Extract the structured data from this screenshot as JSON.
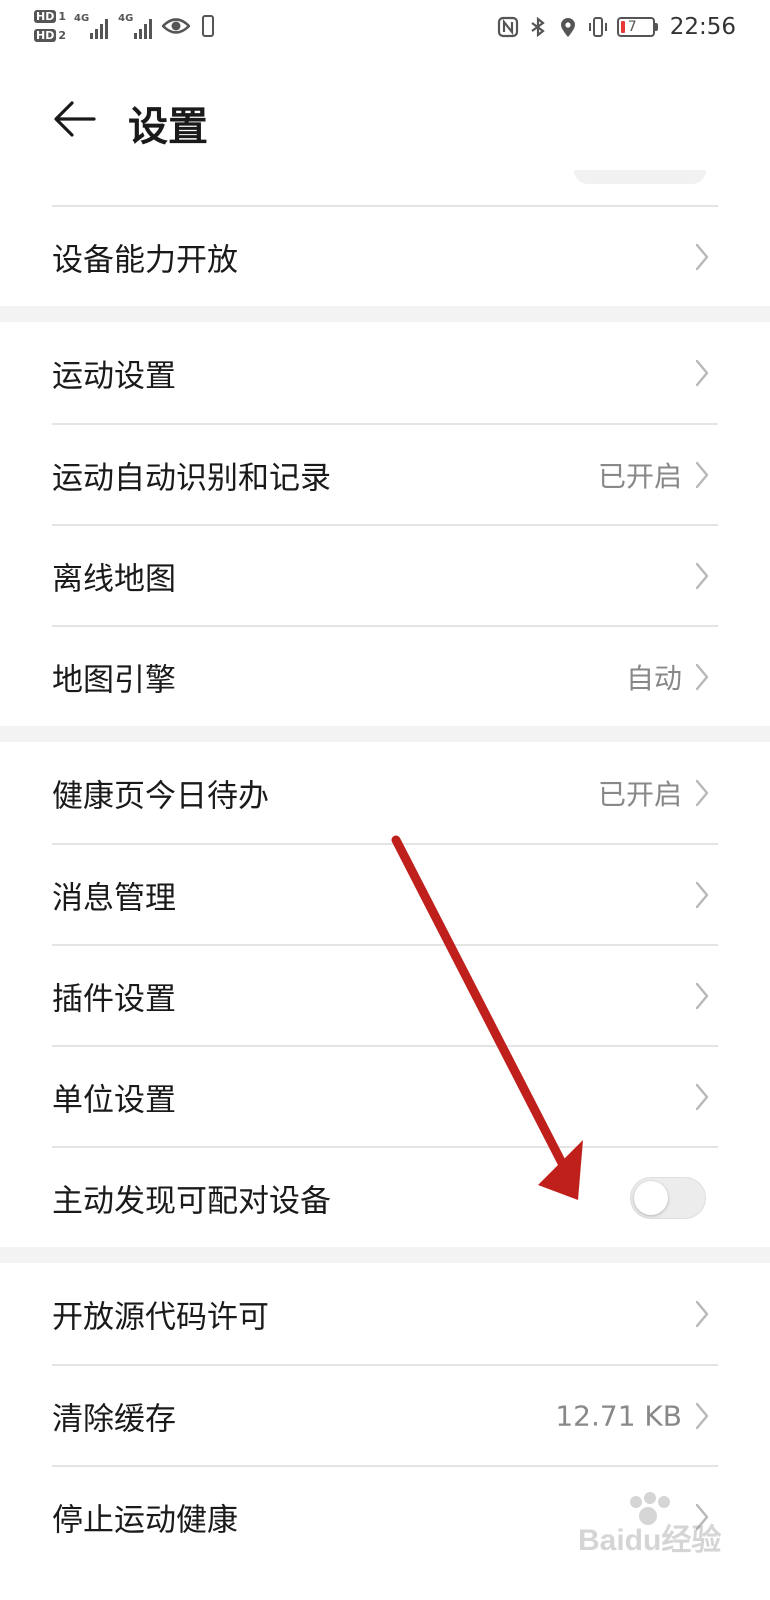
{
  "status_bar": {
    "hd1": "HD",
    "hd1_num": "1",
    "hd2": "HD",
    "hd2_num": "2",
    "net1": "4G",
    "net2": "4G",
    "battery_level": "7",
    "battery_color": "#e53935",
    "time": "22:56",
    "icons": [
      "nfc-icon",
      "bluetooth-icon",
      "location-icon",
      "vibrate-icon",
      "battery-icon",
      "eye-icon"
    ]
  },
  "header": {
    "back_icon": "back-arrow-icon",
    "title": "设置"
  },
  "groups": [
    {
      "items": [
        {
          "label": "设备能力开放",
          "value": "",
          "type": "link"
        }
      ]
    },
    {
      "items": [
        {
          "label": "运动设置",
          "value": "",
          "type": "link"
        },
        {
          "label": "运动自动识别和记录",
          "value": "已开启",
          "type": "link"
        },
        {
          "label": "离线地图",
          "value": "",
          "type": "link"
        },
        {
          "label": "地图引擎",
          "value": "自动",
          "type": "link"
        }
      ]
    },
    {
      "items": [
        {
          "label": "健康页今日待办",
          "value": "已开启",
          "type": "link"
        },
        {
          "label": "消息管理",
          "value": "",
          "type": "link"
        },
        {
          "label": "插件设置",
          "value": "",
          "type": "link"
        },
        {
          "label": "单位设置",
          "value": "",
          "type": "link"
        },
        {
          "label": "主动发现可配对设备",
          "value": "",
          "type": "toggle",
          "checked": false
        }
      ]
    },
    {
      "items": [
        {
          "label": "开放源代码许可",
          "value": "",
          "type": "link"
        },
        {
          "label": "清除缓存",
          "value": "12.71 KB",
          "type": "link"
        },
        {
          "label": "停止运动健康",
          "value": "",
          "type": "link"
        }
      ]
    }
  ],
  "annotation": {
    "color": "#c0201c"
  },
  "watermark": {
    "text": "Baidu经验"
  }
}
